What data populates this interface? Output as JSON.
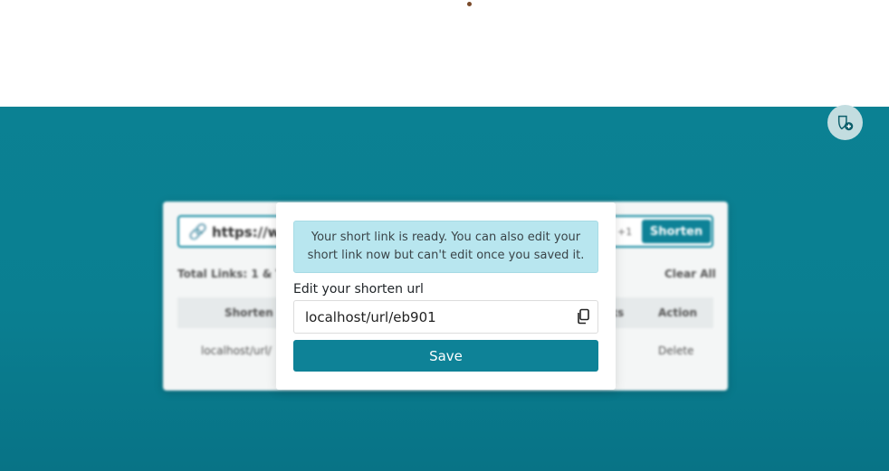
{
  "colors": {
    "teal_background": "#0b8193",
    "accent": "#0e8297",
    "alert_background": "#b8e6ef"
  },
  "corner_button": {
    "icon": "shield-plus-icon"
  },
  "background_app": {
    "url_input_value": "https://w",
    "char_count": "+1",
    "shorten_label": "Shorten",
    "total_links": "Total Links: 1 & To",
    "clear_all_label": "Clear All",
    "table": {
      "headers": [
        "Shorten U",
        "ks",
        "Action"
      ],
      "row": {
        "short_url": "localhost/url/",
        "action": "Delete"
      }
    }
  },
  "modal": {
    "alert_text": "Your short link is ready. You can also edit your short link now but can't edit once you saved it.",
    "edit_label": "Edit your shorten url",
    "input_value": "localhost/url/eb901",
    "copy_icon": "copy-icon",
    "save_label": "Save"
  }
}
